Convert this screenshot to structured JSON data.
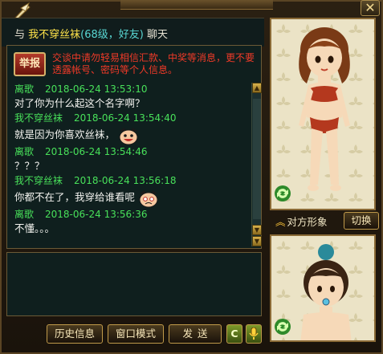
{
  "title": {
    "prefix": "与",
    "name": "我不穿丝袜",
    "level": "(68级，好友)",
    "suffix": "聊天"
  },
  "report_button": "举报",
  "warning": "交谈中请勿轻易相信汇款、中奖等消息，更不要透露帐号、密码等个人信息。",
  "messages": [
    {
      "sender": "离歌",
      "time": "2018-06-24 13:53:10",
      "text": "对了你为什么起这个名字啊？",
      "emote": ""
    },
    {
      "sender": "我不穿丝袜",
      "time": "2018-06-24 13:54:40",
      "text": "就是因为你喜欢丝袜，",
      "emote": "grin-emote"
    },
    {
      "sender": "离歌",
      "time": "2018-06-24 13:54:46",
      "text": "？？？",
      "emote": ""
    },
    {
      "sender": "我不穿丝袜",
      "time": "2018-06-24 13:56:18",
      "text": "你都不在了，我穿给谁看呢",
      "emote": "sad-emote"
    },
    {
      "sender": "离歌",
      "time": "2018-06-24 13:56:36",
      "text": "不懂。。。",
      "emote": ""
    }
  ],
  "buttons": {
    "history": "历史信息",
    "window_mode": "窗口模式",
    "send": "发送",
    "c": "C"
  },
  "other_look": "对方形象",
  "switch": "切换",
  "icons": {
    "close": "close-icon",
    "rotate": "rotate-icon",
    "mic": "mic-icon",
    "pen": "quill-pen-icon"
  },
  "colors": {
    "warning": "#f03a28",
    "sender": "#48e05a",
    "name_highlight": "#ffe44a",
    "level": "#58d6d2"
  }
}
